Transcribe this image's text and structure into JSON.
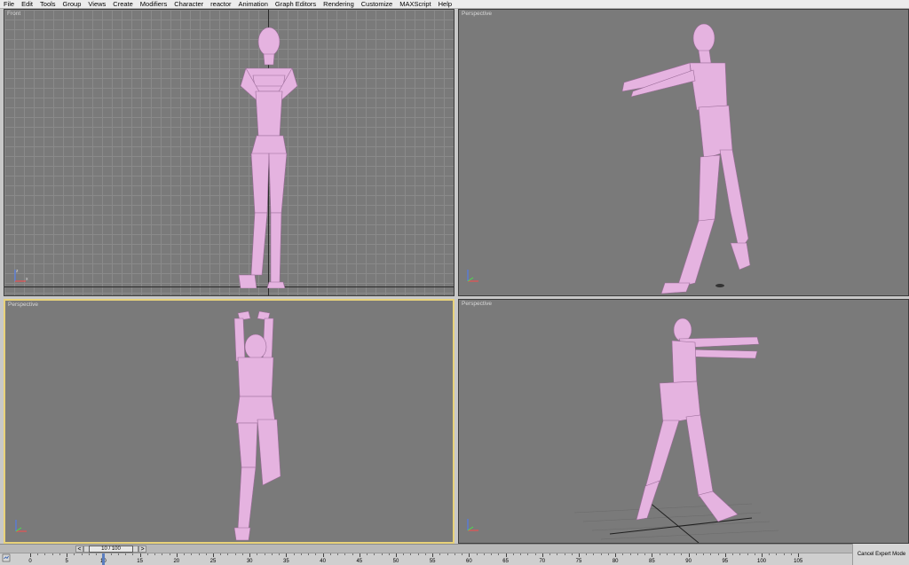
{
  "menu": {
    "items": [
      "File",
      "Edit",
      "Tools",
      "Group",
      "Views",
      "Create",
      "Modifiers",
      "Character",
      "reactor",
      "Animation",
      "Graph Editors",
      "Rendering",
      "Customize",
      "MAXScript",
      "Help"
    ]
  },
  "viewports": {
    "front": {
      "label": "Front"
    },
    "top_right": {
      "label": "Perspective"
    },
    "bottom_left": {
      "label": "Perspective"
    },
    "bottom_right": {
      "label": "Perspective"
    }
  },
  "timeline": {
    "frame_readout": "10 / 100",
    "prev_arrow": "<",
    "next_arrow": ">",
    "current_frame": 10,
    "total_frames": 100,
    "ruler_labels": [
      "0",
      "5",
      "10",
      "15",
      "20",
      "25",
      "30",
      "35",
      "40",
      "45",
      "50",
      "55",
      "60",
      "65",
      "70",
      "75",
      "80",
      "85",
      "90",
      "95",
      "100",
      "105"
    ]
  },
  "status": {
    "cancel_expert": "Cancel Expert Mode"
  },
  "colors": {
    "figure": "#e5b3e0",
    "viewport_bg": "#7a7a7a",
    "active_border": "#e8d27a"
  },
  "icons": {
    "keyframe": "keyframe-icon",
    "axis": "axis-tripod-icon"
  }
}
